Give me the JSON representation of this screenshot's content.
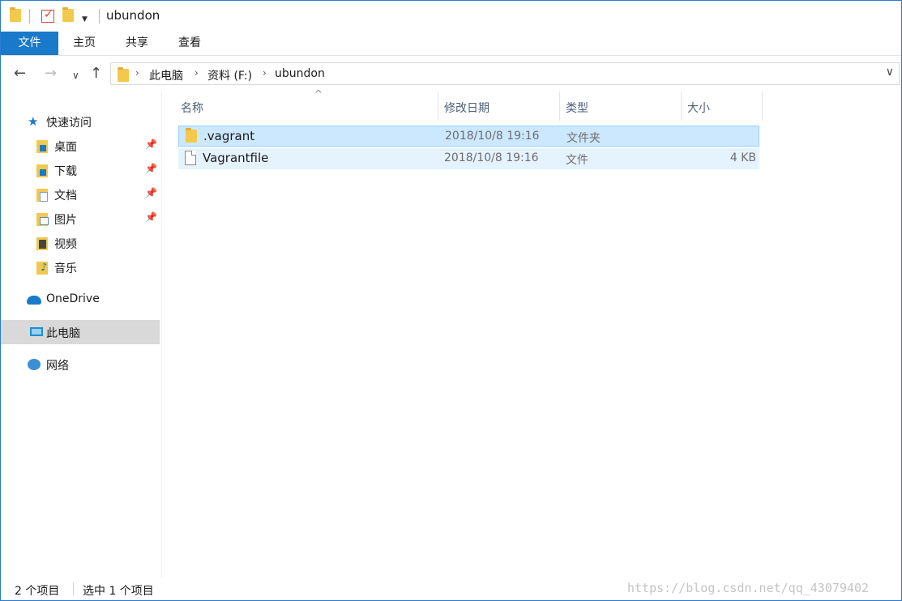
{
  "window": {
    "title": "ubundon",
    "accent": "#1979ca"
  },
  "ribbon": {
    "tabs": [
      {
        "label": "文件"
      },
      {
        "label": "主页"
      },
      {
        "label": "共享"
      },
      {
        "label": "查看"
      }
    ]
  },
  "address": {
    "segments": [
      "此电脑",
      "资料 (F:)",
      "ubundon"
    ]
  },
  "sidebar": {
    "quick_access": "快速访问",
    "items": [
      {
        "label": "桌面",
        "pinned": true
      },
      {
        "label": "下载",
        "pinned": true
      },
      {
        "label": "文档",
        "pinned": true
      },
      {
        "label": "图片",
        "pinned": true
      },
      {
        "label": "视频",
        "pinned": false
      },
      {
        "label": "音乐",
        "pinned": false
      }
    ],
    "onedrive": "OneDrive",
    "this_pc": "此电脑",
    "network": "网络"
  },
  "columns": {
    "name": "名称",
    "date": "修改日期",
    "type": "类型",
    "size": "大小"
  },
  "files": [
    {
      "name": ".vagrant",
      "date": "2018/10/8 19:16",
      "type": "文件夹",
      "size": ""
    },
    {
      "name": "Vagrantfile",
      "date": "2018/10/8 19:16",
      "type": "文件",
      "size": "4 KB"
    }
  ],
  "status": {
    "count": "2 个项目",
    "selected": "选中 1 个项目"
  },
  "watermark": "https://blog.csdn.net/qq_43079402"
}
